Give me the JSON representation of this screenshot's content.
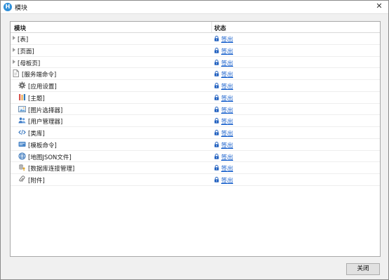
{
  "window": {
    "title": "模块",
    "app_icon_letter": "H"
  },
  "table": {
    "headers": {
      "module": "模块",
      "status": "状态"
    },
    "rows": [
      {
        "label": "[表]",
        "status": "签出",
        "expandable": true,
        "icon": ""
      },
      {
        "label": "[页面]",
        "status": "签出",
        "expandable": true,
        "icon": ""
      },
      {
        "label": "[母板页]",
        "status": "签出",
        "expandable": true,
        "icon": ""
      },
      {
        "label": "[服务端命令]",
        "status": "签出",
        "expandable": false,
        "icon": "document-icon"
      },
      {
        "label": "[应用设置]",
        "status": "签出",
        "expandable": false,
        "icon": "gear-icon"
      },
      {
        "label": "[主题]",
        "status": "签出",
        "expandable": false,
        "icon": "theme-icon"
      },
      {
        "label": "[图片选择器]",
        "status": "签出",
        "expandable": false,
        "icon": "image-icon"
      },
      {
        "label": "[用户管理器]",
        "status": "签出",
        "expandable": false,
        "icon": "users-icon"
      },
      {
        "label": "[类库]",
        "status": "签出",
        "expandable": false,
        "icon": "code-icon"
      },
      {
        "label": "[模板命令]",
        "status": "签出",
        "expandable": false,
        "icon": "template-icon"
      },
      {
        "label": "[地图JSON文件]",
        "status": "签出",
        "expandable": false,
        "icon": "globe-icon"
      },
      {
        "label": "[数据库连接管理]",
        "status": "签出",
        "expandable": false,
        "icon": "database-key-icon"
      },
      {
        "label": "[附件]",
        "status": "签出",
        "expandable": false,
        "icon": "paperclip-icon"
      }
    ]
  },
  "buttons": {
    "close_label": "关闭"
  },
  "colors": {
    "link": "#0b57c9",
    "lock": "#1f5fbf"
  }
}
